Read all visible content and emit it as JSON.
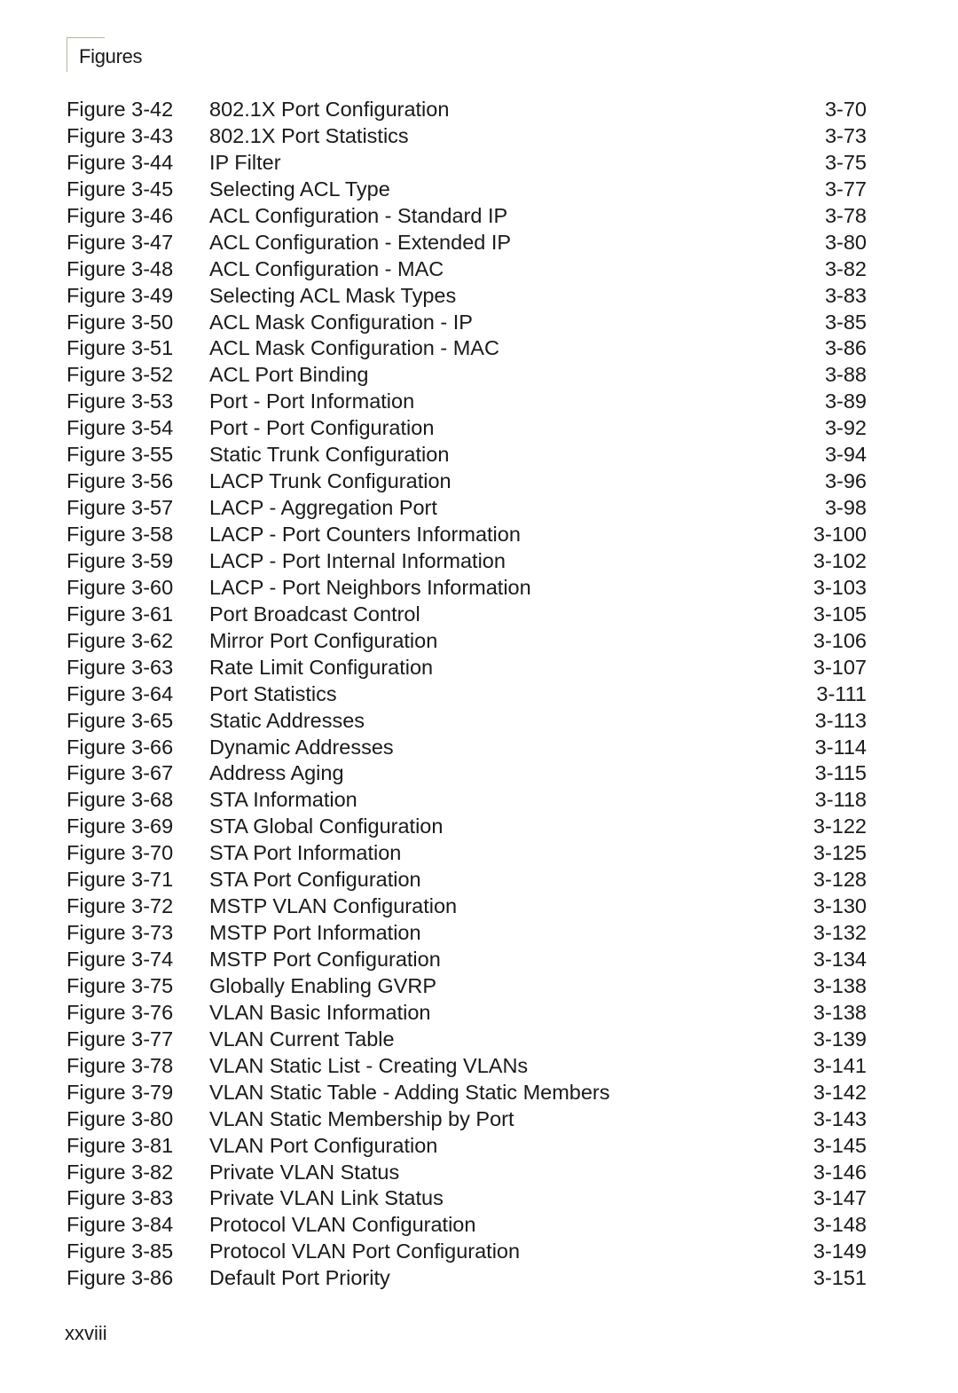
{
  "header": {
    "title": "Figures"
  },
  "entries": [
    {
      "number": "Figure 3-42",
      "title": "802.1X Port Configuration",
      "page": "3-70"
    },
    {
      "number": "Figure 3-43",
      "title": "802.1X Port Statistics",
      "page": "3-73"
    },
    {
      "number": "Figure 3-44",
      "title": "IP Filter",
      "page": "3-75"
    },
    {
      "number": "Figure 3-45",
      "title": "Selecting ACL Type",
      "page": "3-77"
    },
    {
      "number": "Figure 3-46",
      "title": "ACL Configuration - Standard IP",
      "page": "3-78"
    },
    {
      "number": "Figure 3-47",
      "title": "ACL Configuration - Extended IP",
      "page": "3-80"
    },
    {
      "number": "Figure 3-48",
      "title": "ACL Configuration - MAC",
      "page": "3-82"
    },
    {
      "number": "Figure 3-49",
      "title": "Selecting ACL Mask Types",
      "page": "3-83"
    },
    {
      "number": "Figure 3-50",
      "title": "ACL Mask Configuration - IP",
      "page": "3-85"
    },
    {
      "number": "Figure 3-51",
      "title": "ACL Mask Configuration - MAC",
      "page": "3-86"
    },
    {
      "number": "Figure 3-52",
      "title": "ACL Port Binding",
      "page": "3-88"
    },
    {
      "number": "Figure 3-53",
      "title": "Port - Port Information",
      "page": "3-89"
    },
    {
      "number": "Figure 3-54",
      "title": "Port - Port Configuration",
      "page": "3-92"
    },
    {
      "number": "Figure 3-55",
      "title": "Static Trunk Configuration",
      "page": "3-94"
    },
    {
      "number": "Figure 3-56",
      "title": "LACP Trunk Configuration",
      "page": "3-96"
    },
    {
      "number": "Figure 3-57",
      "title": "LACP - Aggregation Port",
      "page": "3-98"
    },
    {
      "number": "Figure 3-58",
      "title": "LACP - Port Counters Information",
      "page": "3-100"
    },
    {
      "number": "Figure 3-59",
      "title": "LACP - Port Internal Information",
      "page": "3-102"
    },
    {
      "number": "Figure 3-60",
      "title": "LACP - Port Neighbors Information",
      "page": "3-103"
    },
    {
      "number": "Figure 3-61",
      "title": "Port Broadcast Control",
      "page": "3-105"
    },
    {
      "number": "Figure 3-62",
      "title": "Mirror Port Configuration",
      "page": "3-106"
    },
    {
      "number": "Figure 3-63",
      "title": "Rate Limit Configuration",
      "page": "3-107"
    },
    {
      "number": "Figure 3-64",
      "title": "Port Statistics",
      "page": "3-111"
    },
    {
      "number": "Figure 3-65",
      "title": "Static Addresses",
      "page": "3-113"
    },
    {
      "number": "Figure 3-66",
      "title": "Dynamic Addresses",
      "page": "3-114"
    },
    {
      "number": "Figure 3-67",
      "title": "Address Aging",
      "page": "3-115"
    },
    {
      "number": "Figure 3-68",
      "title": "STA Information",
      "page": "3-118"
    },
    {
      "number": "Figure 3-69",
      "title": "STA Global Configuration",
      "page": "3-122"
    },
    {
      "number": "Figure 3-70",
      "title": "STA Port Information",
      "page": "3-125"
    },
    {
      "number": "Figure 3-71",
      "title": "STA Port Configuration",
      "page": "3-128"
    },
    {
      "number": "Figure 3-72",
      "title": "MSTP VLAN Configuration",
      "page": "3-130"
    },
    {
      "number": "Figure 3-73",
      "title": "MSTP Port Information",
      "page": "3-132"
    },
    {
      "number": "Figure 3-74",
      "title": "MSTP Port Configuration",
      "page": "3-134"
    },
    {
      "number": "Figure 3-75",
      "title": "Globally Enabling GVRP",
      "page": "3-138"
    },
    {
      "number": "Figure 3-76",
      "title": "VLAN Basic Information",
      "page": "3-138"
    },
    {
      "number": "Figure 3-77",
      "title": "VLAN Current Table",
      "page": "3-139"
    },
    {
      "number": "Figure 3-78",
      "title": "VLAN Static List - Creating VLANs",
      "page": "3-141"
    },
    {
      "number": "Figure 3-79",
      "title": "VLAN Static Table - Adding Static Members",
      "page": "3-142"
    },
    {
      "number": "Figure 3-80",
      "title": "VLAN Static Membership by Port",
      "page": "3-143"
    },
    {
      "number": "Figure 3-81",
      "title": "VLAN Port Configuration",
      "page": "3-145"
    },
    {
      "number": "Figure 3-82",
      "title": "Private VLAN Status",
      "page": "3-146"
    },
    {
      "number": "Figure 3-83",
      "title": "Private VLAN Link Status",
      "page": "3-147"
    },
    {
      "number": "Figure 3-84",
      "title": "Protocol VLAN Configuration",
      "page": "3-148"
    },
    {
      "number": "Figure 3-85",
      "title": "Protocol VLAN Port Configuration",
      "page": "3-149"
    },
    {
      "number": "Figure 3-86",
      "title": "Default Port Priority",
      "page": "3-151"
    }
  ],
  "footer": {
    "page_number": "xxviii"
  }
}
